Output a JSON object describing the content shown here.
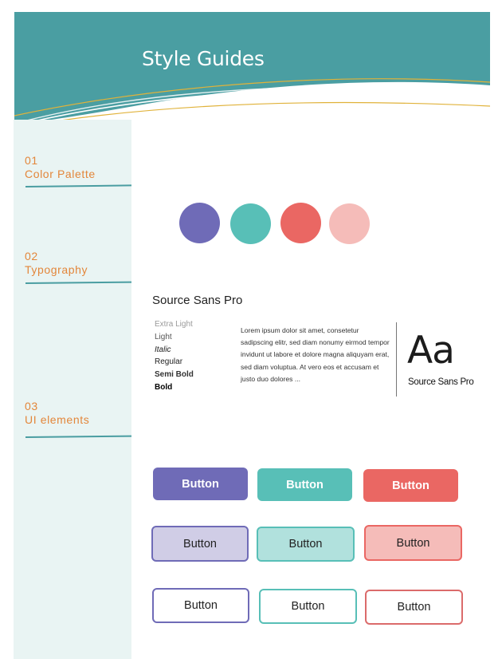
{
  "header": {
    "title": "Style Guides"
  },
  "sidebar": {
    "items": [
      {
        "number": "01",
        "label": "Color Palette"
      },
      {
        "number": "02",
        "label": "Typography"
      },
      {
        "number": "03",
        "label": "UI elements"
      }
    ]
  },
  "colors": {
    "header_teal": "#4a9ea2",
    "sidebar_bg": "#e9f4f3",
    "accent_orange": "#e3863a",
    "curve_gold": "#e0b23a",
    "palette": [
      "#6f6bb7",
      "#58bfb7",
      "#ea6763",
      "#f5bcb9"
    ]
  },
  "typography": {
    "font_name": "Source Sans Pro",
    "weights": [
      "Extra Light",
      "Light",
      "Italic",
      "Regular",
      "Semi Bold",
      "Bold"
    ],
    "sample_text": "Lorem ipsum dolor sit amet, consetetur sadipscing elitr, sed diam nonumy eirmod tempor invidunt ut labore et dolore magna aliquyam erat, sed diam voluptua. At vero eos et accusam et justo duo dolores ...",
    "specimen": "Aa",
    "specimen_label": "Source Sans Pro"
  },
  "buttons": {
    "solid": [
      {
        "label": "Button",
        "color": "#6f6bb7"
      },
      {
        "label": "Button",
        "color": "#58bfb7"
      },
      {
        "label": "Button",
        "color": "#ea6763"
      }
    ],
    "soft": [
      {
        "label": "Button",
        "bg": "#d0cde6",
        "border": "#6f6bb7"
      },
      {
        "label": "Button",
        "bg": "#b1e1dd",
        "border": "#58bfb7"
      },
      {
        "label": "Button",
        "bg": "#f5bcb9",
        "border": "#ea6763"
      }
    ],
    "outline": [
      {
        "label": "Button",
        "border": "#6f6bb7"
      },
      {
        "label": "Button",
        "border": "#58bfb7"
      },
      {
        "label": "Button",
        "border": "#db6b6b"
      }
    ]
  }
}
